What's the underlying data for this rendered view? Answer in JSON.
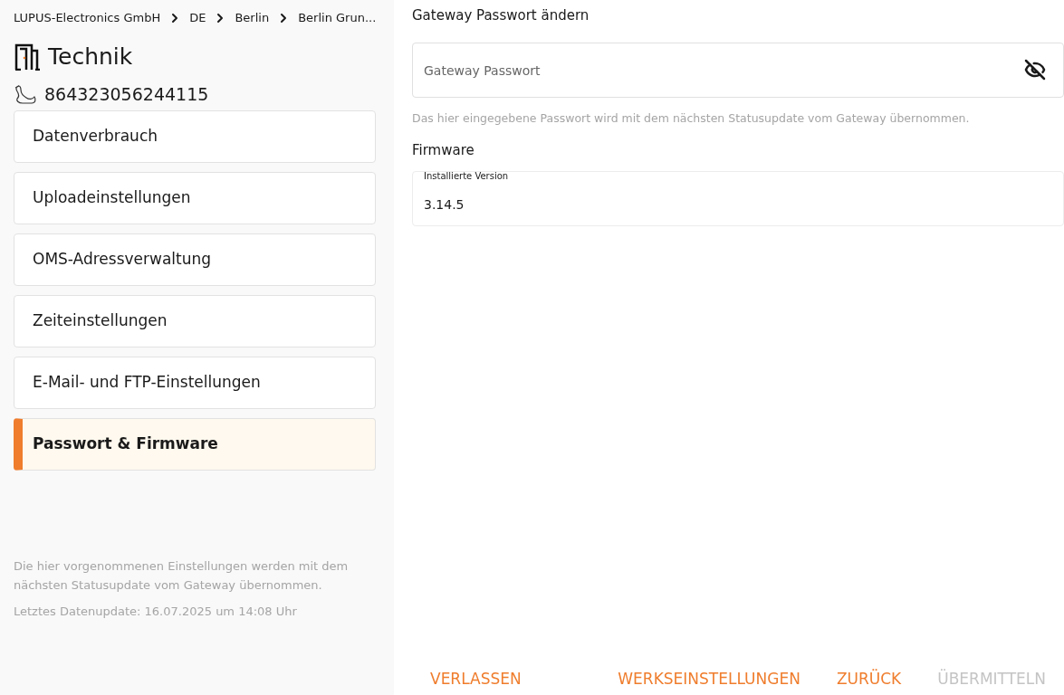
{
  "breadcrumb": [
    "LUPUS-Electronics GmbH",
    "DE",
    "Berlin",
    "Berlin Grun..."
  ],
  "title": "Technik",
  "device_id": "864323056244115",
  "menu": [
    {
      "label": "Datenverbrauch",
      "selected": false
    },
    {
      "label": "Uploadeinstellungen",
      "selected": false
    },
    {
      "label": "OMS-Adressverwaltung",
      "selected": false
    },
    {
      "label": "Zeiteinstellungen",
      "selected": false
    },
    {
      "label": "E-Mail- und FTP-Einstellungen",
      "selected": false
    },
    {
      "label": "Passwort & Firmware",
      "selected": true
    }
  ],
  "sidebar_note": "Die hier vorgenommenen Einstellungen werden mit dem nächsten Statusupdate vom Gateway übernommen.",
  "last_update": "Letztes Datenupdate: 16.07.2025 um 14:08 Uhr",
  "password_section": {
    "heading": "Gateway Passwort ändern",
    "placeholder": "Gateway Passwort",
    "visible": false,
    "hint": "Das hier eingegebene Passwort wird mit dem nächsten Statusupdate vom Gateway übernommen."
  },
  "firmware_section": {
    "heading": "Firmware",
    "label": "Installierte Version",
    "value": "3.14.5"
  },
  "left_button": {
    "label": "VERLASSEN",
    "disabled": false
  },
  "buttons": [
    {
      "label": "WERKSEINSTELLUNGEN",
      "disabled": false
    },
    {
      "label": "ZURÜCK",
      "disabled": false
    },
    {
      "label": "ÜBERMITTELN",
      "disabled": true
    }
  ]
}
